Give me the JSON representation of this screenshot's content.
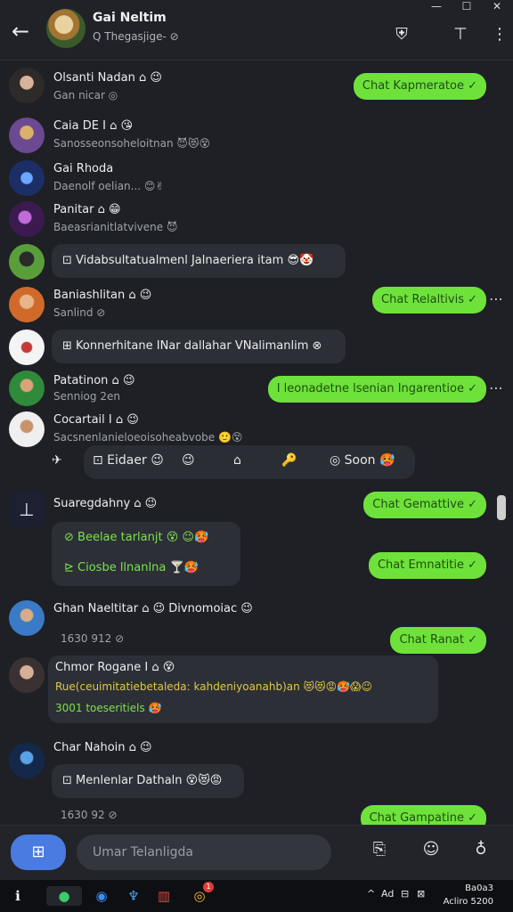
{
  "window": {
    "minimize": "—",
    "maximize": "☐",
    "close": "✕"
  },
  "header": {
    "title": "Gai Neltim",
    "subtitle": "Q Thegasjige- ⊘",
    "back_icon": "arrow-left-icon",
    "actions": [
      "user-icon",
      "tag-icon",
      "more-vertical-icon"
    ]
  },
  "messages": [
    {
      "name": "Olsanti Nadan ⌂ 😉",
      "sub": "Gan nicar ◎",
      "reply": "Chat Kapmeratoe ✓"
    },
    {
      "name": "Caia DE I ⌂ 😘",
      "sub": "Sanosseonsoheloitnan 😈😻😵"
    },
    {
      "name": "Gai Rhoda",
      "sub": "Daenolf oelian... 😊✌"
    },
    {
      "name": "Panitar ⌂ 😁",
      "sub": "Baeasrianitlatvivene 😈"
    },
    {
      "bubble": "⊡ Vidabsultatualmenl Jalnaeriera itam 😎🤡"
    },
    {
      "name": "Baniashlitan ⌂ 😉",
      "sub": "Sanlind ⊘",
      "reply": "Chat Relaltivis ✓"
    },
    {
      "bubble": "⊞ Konnerhitane INar dallahar VNalimanlim ⊗"
    },
    {
      "name": "Patatinon ⌂ 😉",
      "sub": "Senniog 2en",
      "reply": "I leonadetne lsenian Ingarentioe ✓"
    },
    {
      "name": "Cocartail I ⌂ 😉",
      "sub": "Sacsnenlanieloeoisoheabvobe 🙂😵"
    },
    {
      "name": "Suaregdahny ⌂ 😉",
      "reply": "Chat Gemattive ✓"
    },
    {
      "bubble_lines": [
        "⊘ Beelae tarlanjt 😵 😉🥵",
        "⊵ Ciosbe llnanlna 🍸🥵"
      ],
      "reply": "Chat Emnatitie ✓"
    },
    {
      "name": "Ghan Naeltitar ⌂ 😉 Divnomoiac 😉",
      "sub": "1630 912 ⊘",
      "reply": "Chat Ranat ✓"
    },
    {
      "name": "Chmor Rogane I ⌂ 😵",
      "line1": "Rue(ceuimitatiebetaleda: kahdeniyoanahb)an 😻😻😡🥵😱😉",
      "line2": "3001 toeseritiels 🥵"
    },
    {
      "name": "Char Nahoin ⌂ 😉",
      "bubble": "⊡ Menlenlar Dathaln 😵😻😡",
      "sub": "1630 92 ⊘",
      "reply": "Chat Gampatine ✓"
    }
  ],
  "react_bar": [
    "✈",
    "⊡ Eidaer 😉",
    "😉",
    "⌂",
    "🔑",
    "◎ Soon 🥵"
  ],
  "composer": {
    "placeholder": "Umar Telanligda",
    "icons": [
      "attach-icon",
      "sticker-icon",
      "mic-icon"
    ]
  },
  "taskbar": {
    "badge_count": "1",
    "tray_icons": [
      "^",
      "Ad",
      "⊟",
      "⊠"
    ],
    "clock_line1": "Ba0a3",
    "clock_line2": "Acliro 5200"
  },
  "colors": {
    "accent_green": "#6ee23a",
    "bubble": "#2c2f36",
    "compose_button": "#4a7be0"
  }
}
